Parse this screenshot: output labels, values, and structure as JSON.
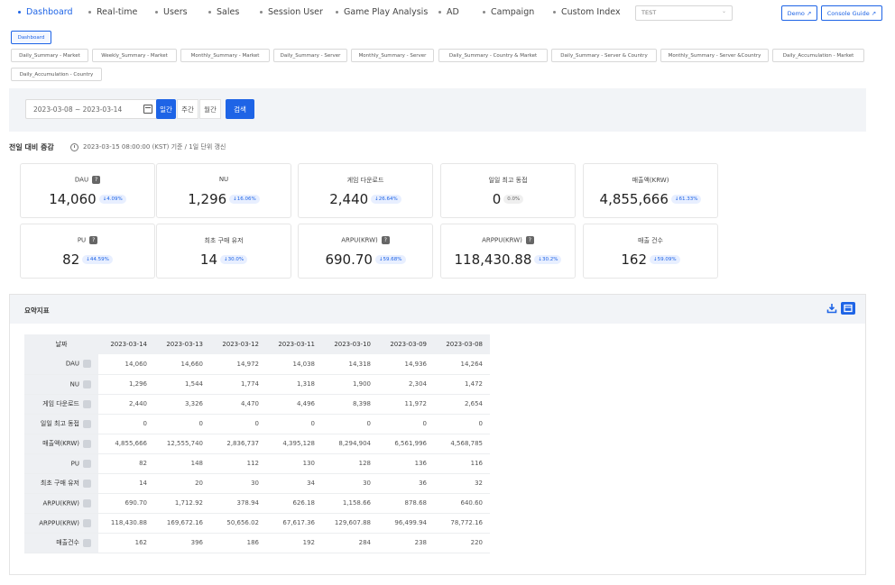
{
  "nav": {
    "items": [
      {
        "label": "Dashboard",
        "active": true
      },
      {
        "label": "Real-time"
      },
      {
        "label": "Users"
      },
      {
        "label": "Sales"
      },
      {
        "label": "Session User"
      },
      {
        "label": "Game Play Analysis"
      },
      {
        "label": "AD"
      },
      {
        "label": "Campaign"
      },
      {
        "label": "Custom Index"
      }
    ],
    "select_value": "TEST",
    "demo_label": "Demo ↗",
    "console_guide_label": "Console Guide ↗"
  },
  "subtabs": {
    "active": "Dashboard",
    "items": [
      "Daily_Summary - Market",
      "Weekly_Summary - Market",
      "Monthly_Summary - Market",
      "Daily_Summary - Server",
      "Monthly_Summary - Server",
      "Daily_Summary - Country & Market",
      "Daily_Summary - Server & Country",
      "Monthly_Summary - Server &Country",
      "Daily_Accumulation - Market",
      "Daily_Accumulation - Country"
    ]
  },
  "filter": {
    "date_range": "2023-03-08 ~ 2023-03-14",
    "periods": [
      "일간",
      "주간",
      "월간"
    ],
    "search_label": "검색"
  },
  "kpi": {
    "section_title": "전일 대비 증감",
    "update_info": "2023-03-15 08:00:00 (KST) 기준 / 1일 단위 갱신",
    "cards": [
      {
        "title": "DAU",
        "help": true,
        "value": "14,060",
        "change": "↓4.09%"
      },
      {
        "title": "NU",
        "help": false,
        "value": "1,296",
        "change": "↓16.06%"
      },
      {
        "title": "게임 다운로드",
        "help": false,
        "value": "2,440",
        "change": "↓26.64%"
      },
      {
        "title": "일일 최고 동접",
        "help": false,
        "value": "0",
        "change": "0.0%"
      },
      {
        "title": "매출액(KRW)",
        "help": false,
        "value": "4,855,666",
        "change": "↓61.33%"
      },
      {
        "title": "PU",
        "help": true,
        "value": "82",
        "change": "↓44.59%"
      },
      {
        "title": "최초 구매 유저",
        "help": false,
        "value": "14",
        "change": "↓30.0%"
      },
      {
        "title": "ARPU(KRW)",
        "help": true,
        "value": "690.70",
        "change": "↓59.68%"
      },
      {
        "title": "ARPPU(KRW)",
        "help": true,
        "value": "118,430.88",
        "change": "↓30.2%"
      },
      {
        "title": "매출 건수",
        "help": false,
        "value": "162",
        "change": "↓59.09%"
      }
    ]
  },
  "summary": {
    "title": "요약지표",
    "header_label": "날짜",
    "dates": [
      "2023-03-14",
      "2023-03-13",
      "2023-03-12",
      "2023-03-11",
      "2023-03-10",
      "2023-03-09",
      "2023-03-08"
    ],
    "rows": [
      {
        "label": "DAU",
        "values": [
          "14,060",
          "14,660",
          "14,972",
          "14,038",
          "14,318",
          "14,936",
          "14,264"
        ]
      },
      {
        "label": "NU",
        "values": [
          "1,296",
          "1,544",
          "1,774",
          "1,318",
          "1,900",
          "2,304",
          "1,472"
        ]
      },
      {
        "label": "게임 다운로드",
        "values": [
          "2,440",
          "3,326",
          "4,470",
          "4,496",
          "8,398",
          "11,972",
          "2,654"
        ]
      },
      {
        "label": "일일 최고 동접",
        "values": [
          "0",
          "0",
          "0",
          "0",
          "0",
          "0",
          "0"
        ]
      },
      {
        "label": "매출액(KRW)",
        "values": [
          "4,855,666",
          "12,555,740",
          "2,836,737",
          "4,395,128",
          "8,294,904",
          "6,561,996",
          "4,568,785"
        ]
      },
      {
        "label": "PU",
        "values": [
          "82",
          "148",
          "112",
          "130",
          "128",
          "136",
          "116"
        ]
      },
      {
        "label": "최초 구매 유저",
        "values": [
          "14",
          "20",
          "30",
          "34",
          "30",
          "36",
          "32"
        ]
      },
      {
        "label": "ARPU(KRW)",
        "values": [
          "690.70",
          "1,712.92",
          "378.94",
          "626.18",
          "1,158.66",
          "878.68",
          "640.60"
        ]
      },
      {
        "label": "ARPPU(KRW)",
        "values": [
          "118,430.88",
          "169,672.16",
          "50,656.02",
          "67,617.36",
          "129,607.88",
          "96,499.94",
          "78,772.16"
        ]
      },
      {
        "label": "매출건수",
        "values": [
          "162",
          "396",
          "186",
          "192",
          "284",
          "238",
          "220"
        ]
      }
    ]
  },
  "colors": {
    "accent": "#1e64e6",
    "panel_bg": "#f2f4f7"
  }
}
